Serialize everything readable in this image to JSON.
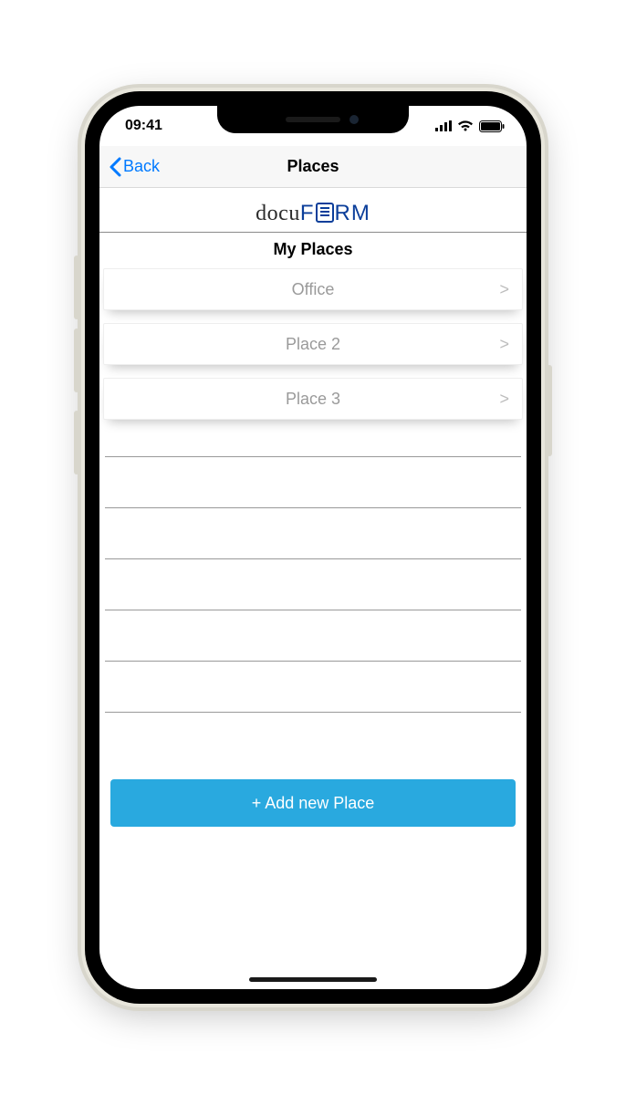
{
  "status": {
    "time": "09:41"
  },
  "nav": {
    "back_label": "Back",
    "title": "Places"
  },
  "brand": {
    "prefix": "docu",
    "suffix": "RM"
  },
  "section": {
    "title": "My Places"
  },
  "places": [
    {
      "label": "Office"
    },
    {
      "label": "Place 2"
    },
    {
      "label": "Place 3"
    }
  ],
  "add_button": {
    "label": "+ Add new Place"
  },
  "colors": {
    "accent": "#29a9df",
    "link": "#007aff",
    "brand_blue": "#0b3e9a"
  }
}
